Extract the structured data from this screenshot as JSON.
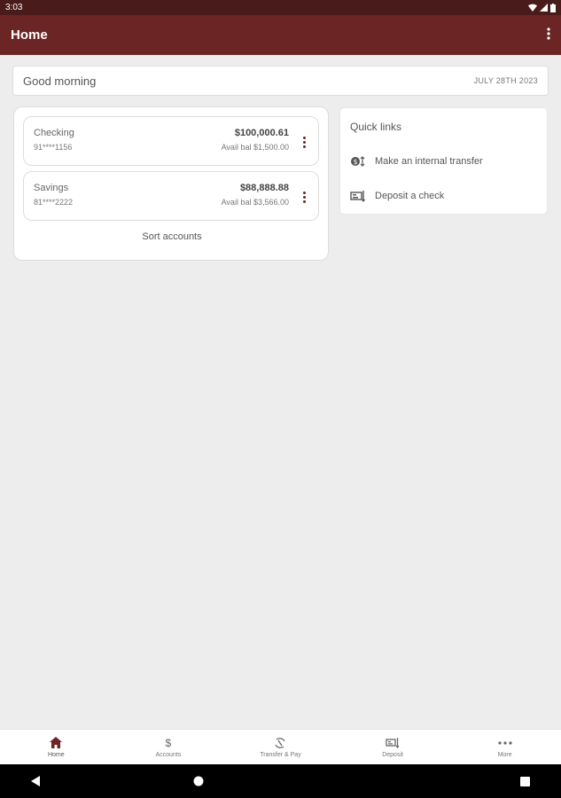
{
  "status_bar": {
    "time": "3:03"
  },
  "app_bar": {
    "title": "Home"
  },
  "greeting_card": {
    "greeting": "Good morning",
    "date": "JULY 28TH 2023"
  },
  "accounts": [
    {
      "name": "Checking",
      "number": "91****1156",
      "balance": "$100,000.61",
      "available": "Avail bal $1,500.00"
    },
    {
      "name": "Savings",
      "number": "81****2222",
      "balance": "$88,888.88",
      "available": "Avail bal $3,566.00"
    }
  ],
  "sort_label": "Sort accounts",
  "quick_links": {
    "title": "Quick links",
    "items": [
      {
        "label": "Make an internal transfer",
        "icon": "transfer-icon"
      },
      {
        "label": "Deposit a check",
        "icon": "check-deposit-icon"
      }
    ]
  },
  "bottom_nav": {
    "items": [
      {
        "label": "Home",
        "icon": "home-icon",
        "active": true
      },
      {
        "label": "Accounts",
        "icon": "dollar-icon"
      },
      {
        "label": "Transfer & Pay",
        "icon": "transfer-pay-icon"
      },
      {
        "label": "Deposit",
        "icon": "deposit-icon"
      },
      {
        "label": "More",
        "icon": "more-icon"
      }
    ]
  },
  "colors": {
    "brand": "#6b2525",
    "status_bar": "#4a1b1b",
    "background": "#ededed"
  }
}
